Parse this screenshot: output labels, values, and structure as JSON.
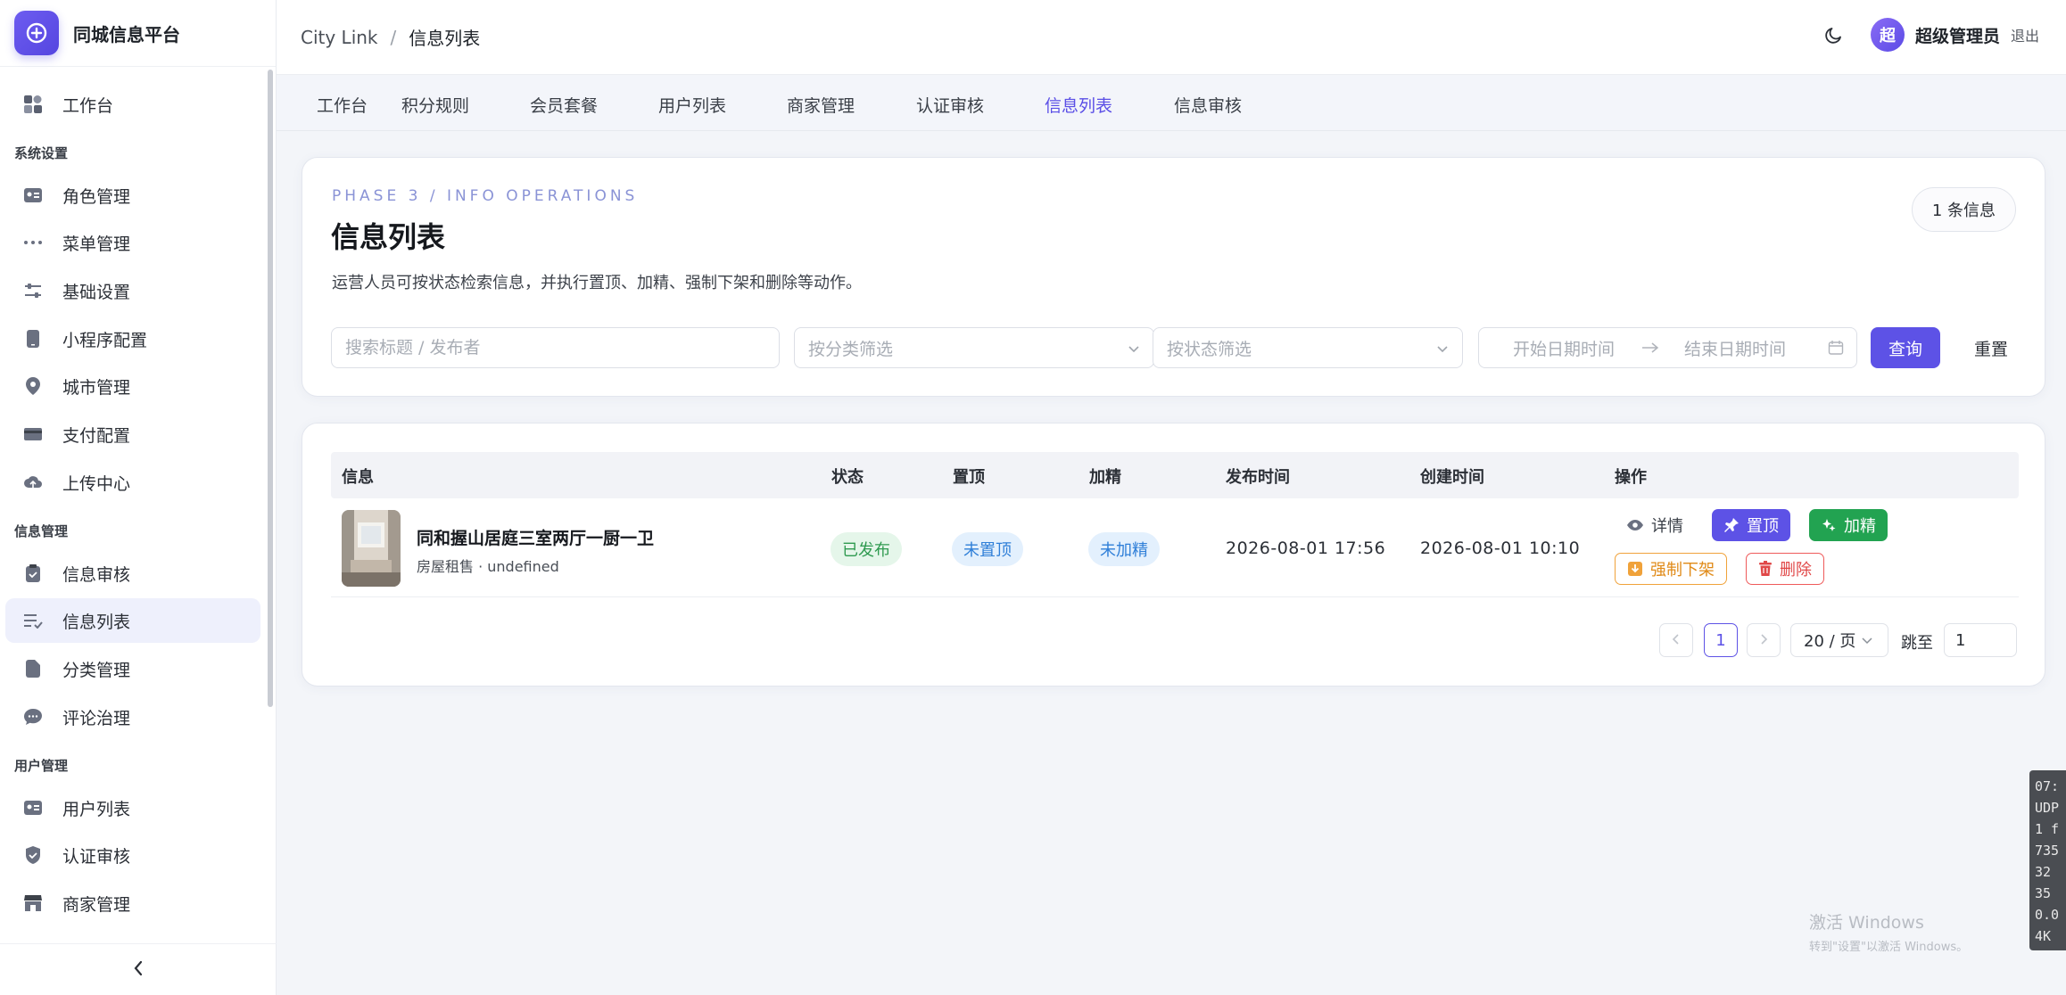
{
  "brand": {
    "title": "同城信息平台"
  },
  "sidebar": {
    "items": [
      {
        "label": "工作台",
        "icon": "dashboard-icon"
      },
      {
        "label": "角色管理",
        "icon": "id-card-icon"
      },
      {
        "label": "菜单管理",
        "icon": "dots-icon"
      },
      {
        "label": "基础设置",
        "icon": "sliders-icon"
      },
      {
        "label": "小程序配置",
        "icon": "phone-icon"
      },
      {
        "label": "城市管理",
        "icon": "location-icon"
      },
      {
        "label": "支付配置",
        "icon": "card-icon"
      },
      {
        "label": "上传中心",
        "icon": "cloud-upload-icon"
      },
      {
        "label": "信息审核",
        "icon": "clipboard-icon"
      },
      {
        "label": "信息列表",
        "icon": "list-check-icon"
      },
      {
        "label": "分类管理",
        "icon": "folder-icon"
      },
      {
        "label": "评论治理",
        "icon": "comment-icon"
      },
      {
        "label": "用户列表",
        "icon": "user-card-icon"
      },
      {
        "label": "认证审核",
        "icon": "shield-check-icon"
      },
      {
        "label": "商家管理",
        "icon": "store-icon"
      }
    ],
    "groups": {
      "system": "系统设置",
      "info": "信息管理",
      "user": "用户管理"
    },
    "active_item": "信息列表"
  },
  "topbar": {
    "breadcrumb_root": "City Link",
    "breadcrumb_sep": "/",
    "breadcrumb_current": "信息列表",
    "avatar_char": "超",
    "username": "超级管理员",
    "logout": "退出"
  },
  "tabs": [
    "工作台",
    "积分规则",
    "会员套餐",
    "用户列表",
    "商家管理",
    "认证审核",
    "信息列表",
    "信息审核"
  ],
  "header": {
    "eyebrow": "PHASE 3 / INFO OPERATIONS",
    "title": "信息列表",
    "description": "运营人员可按状态检索信息，并执行置顶、加精、强制下架和删除等动作。",
    "count_badge": "1 条信息"
  },
  "filters": {
    "search_placeholder": "搜索标题 / 发布者",
    "category_placeholder": "按分类筛选",
    "status_placeholder": "按状态筛选",
    "start_placeholder": "开始日期时间",
    "end_placeholder": "结束日期时间",
    "query": "查询",
    "reset": "重置"
  },
  "table": {
    "columns": [
      "信息",
      "状态",
      "置顶",
      "加精",
      "发布时间",
      "创建时间",
      "操作"
    ],
    "rows": [
      {
        "title": "同和握山居庭三室两厅一厨一卫",
        "subtitle": "房屋租售 · undefined",
        "status": "已发布",
        "top": "未置顶",
        "featured": "未加精",
        "published_at": "2026-08-01 17:56",
        "created_at": "2026-08-01 10:10",
        "actions": {
          "detail": "详情",
          "pin": "置顶",
          "feature": "加精",
          "takedown": "强制下架",
          "delete": "删除"
        }
      }
    ]
  },
  "pagination": {
    "current": "1",
    "page_size": "20 / 页",
    "jump_label": "跳至",
    "jump_value": "1"
  },
  "watermark": {
    "line1": "激活 Windows",
    "line2": "转到\"设置\"以激活 Windows。"
  },
  "overlay_lines": [
    "07:",
    "UDP",
    "1 f",
    "735",
    "32 ",
    "35 ",
    "0.0",
    "4K "
  ],
  "colors": {
    "accent": "#5d52e6",
    "success": "#22a351",
    "warning": "#e08a17",
    "danger": "#e04848"
  }
}
